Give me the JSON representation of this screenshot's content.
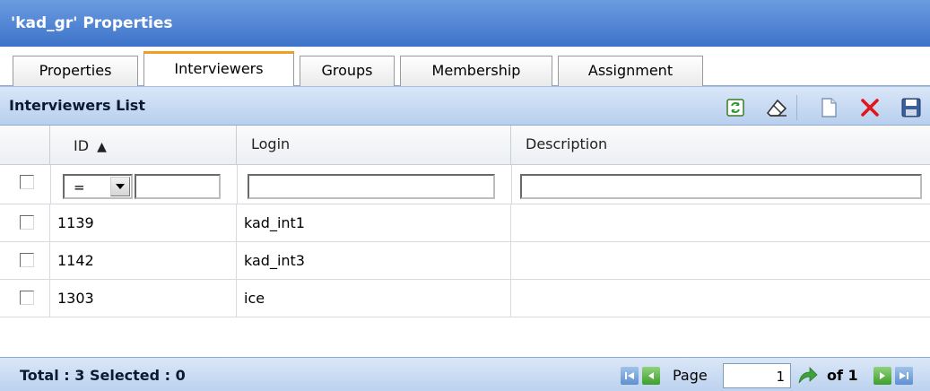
{
  "window": {
    "title": "'kad_gr' Properties"
  },
  "tabs": [
    {
      "label": "Properties",
      "active": false
    },
    {
      "label": "Interviewers",
      "active": true
    },
    {
      "label": "Groups",
      "active": false
    },
    {
      "label": "Membership",
      "active": false
    },
    {
      "label": "Assignment",
      "active": false
    }
  ],
  "list": {
    "title": "Interviewers List",
    "toolbar": [
      "refresh-icon",
      "eraser-icon",
      "new-document-icon",
      "delete-icon",
      "save-icon"
    ]
  },
  "columns": {
    "id": "ID",
    "id_sort_glyph": "▲",
    "login": "Login",
    "description": "Description"
  },
  "filter": {
    "operator": "="
  },
  "rows": [
    {
      "id": "1139",
      "login": "kad_int1",
      "description": ""
    },
    {
      "id": "1142",
      "login": "kad_int3",
      "description": ""
    },
    {
      "id": "1303",
      "login": "ice",
      "description": ""
    }
  ],
  "footer": {
    "summary": "Total : 3 Selected : 0",
    "page_label": "Page",
    "page_value": "1",
    "of_label": "of 1"
  },
  "colors": {
    "title_bar": "#4a7fd2",
    "active_tab_accent": "#f0a020",
    "delete_red": "#e0161b",
    "nav_green": "#4caf3a"
  }
}
